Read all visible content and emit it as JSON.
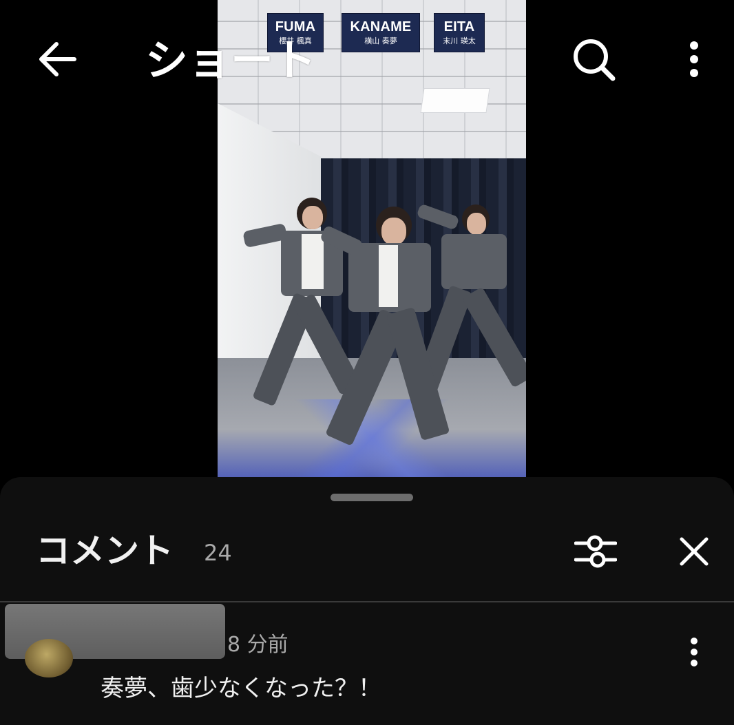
{
  "header": {
    "title": "ショート",
    "back_icon": "arrow-left-icon",
    "search_icon": "search-icon",
    "menu_icon": "more-vertical-icon"
  },
  "video": {
    "badges": [
      {
        "name": "FUMA",
        "jp": "櫻井 楓真"
      },
      {
        "name": "KANAME",
        "jp": "横山 奏夢"
      },
      {
        "name": "EITA",
        "jp": "末川 瑛太"
      }
    ]
  },
  "comments": {
    "title": "コメント",
    "count": "24",
    "filter_icon": "sliders-icon",
    "close_icon": "close-icon",
    "items": [
      {
        "time": "8 分前",
        "text": "奏夢、歯少なくなった？！",
        "menu_icon": "more-vertical-icon"
      }
    ]
  }
}
